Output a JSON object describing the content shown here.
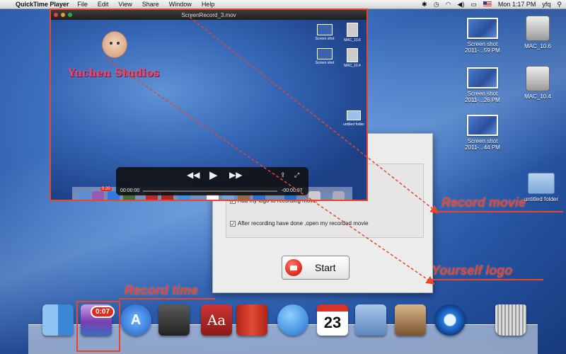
{
  "menubar": {
    "app_name": "QuickTime Player",
    "menus": [
      "File",
      "Edit",
      "View",
      "Share",
      "Window",
      "Help"
    ],
    "clock": "Mon 1:17 PM",
    "user": "yfq"
  },
  "desktop_icons": [
    {
      "label": "Screen shot 2011-...59 PM",
      "kind": "screenshot"
    },
    {
      "label": "MAC_10.6",
      "kind": "drive"
    },
    {
      "label": "Screen shot 2011-...26 PM",
      "kind": "screenshot"
    },
    {
      "label": "MAC_10.4",
      "kind": "drive"
    },
    {
      "label": "Screen shot 2011-...44 PM",
      "kind": "screenshot"
    },
    {
      "label": "untitled folder",
      "kind": "folder"
    }
  ],
  "quicktime": {
    "title": "ScreenRecord_3.mov",
    "watermark": "Yuchen Studios",
    "time_elapsed": "00:00:00",
    "time_remaining": "-00:00:07",
    "dock_badge": "0:20",
    "mini_icons": [
      "Screen shot",
      "MAC_10.6",
      "Screen shot",
      "MAC_10.4",
      "untitled folder"
    ]
  },
  "dialog": {
    "option1": "Add my logo to recording movie",
    "option2": "After  recording have done ,open my  recorded movie",
    "start_label": "Start"
  },
  "annotations": {
    "record_movie": "Record movie",
    "yourself_logo": "Yourself  logo",
    "record_time": "Record time"
  },
  "dock": {
    "badge": "0:07",
    "calendar_day": "23",
    "dictionary_text": "Aa"
  },
  "colors": {
    "annotation": "#e8452a",
    "badge": "#e02a1d"
  }
}
